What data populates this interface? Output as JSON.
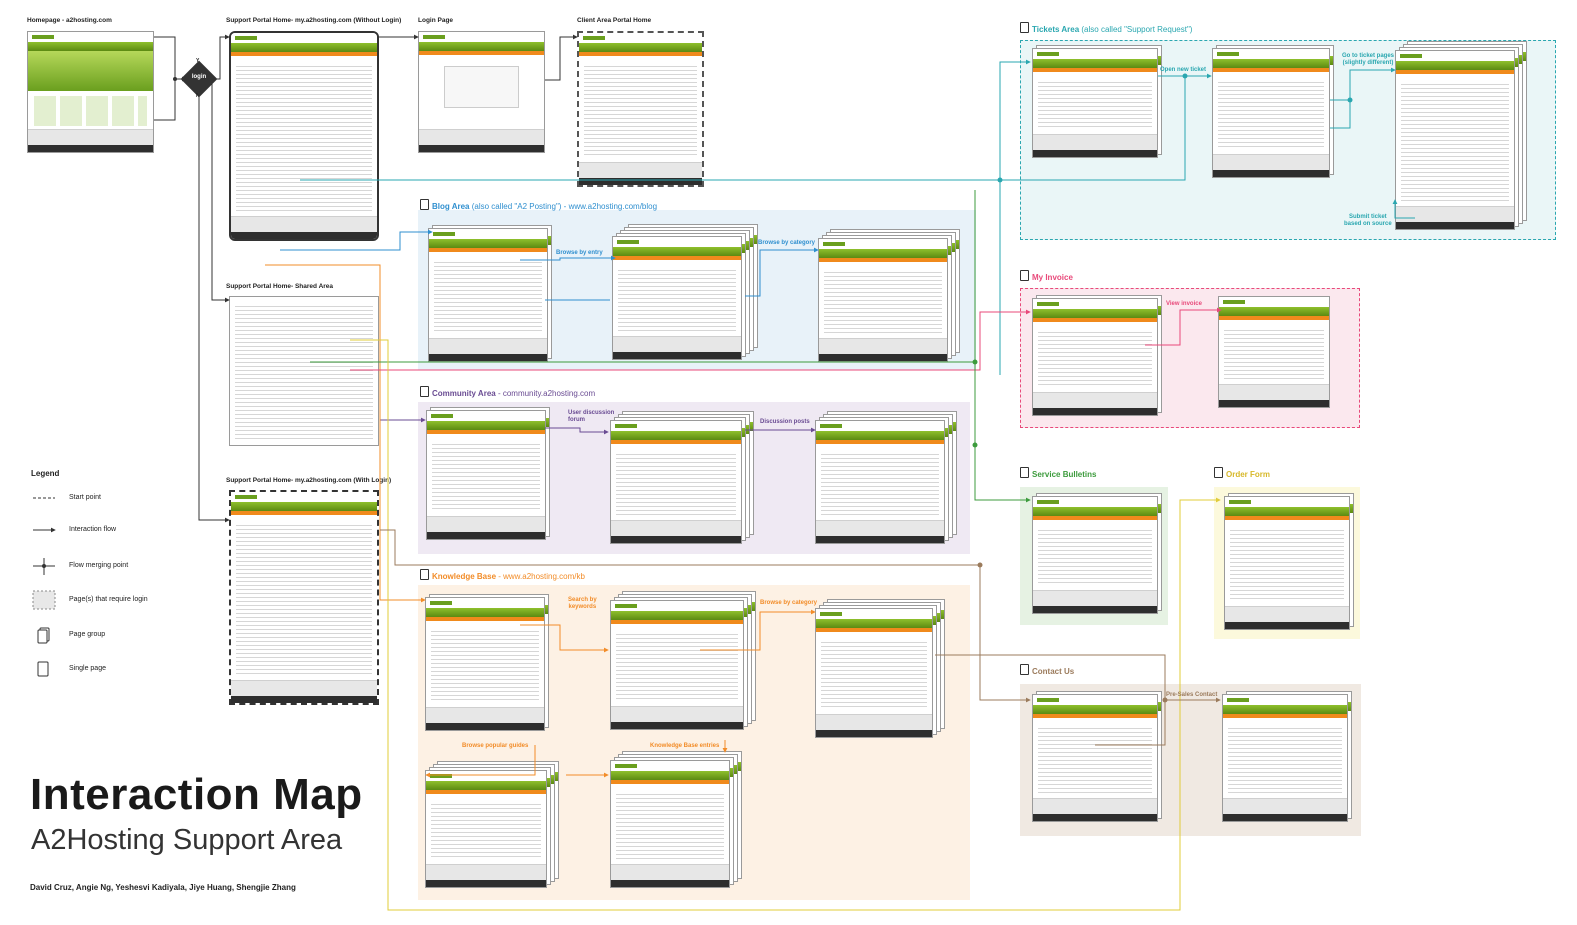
{
  "title": "Interaction Map",
  "subtitle": "A2Hosting Support Area",
  "authors": "David Cruz, Angie Ng, Yeshesvi Kadiyala, Jiye Huang, Shengjie Zhang",
  "pages": {
    "homepage": "Homepage - a2hosting.com",
    "portal_without_login": "Support Portal Home- my.a2hosting.com (Without Login)",
    "login_page": "Login Page",
    "client_area": "Client Area Portal Home",
    "portal_shared": "Support Portal Home- Shared Area",
    "portal_with_login": "Support Portal Home- my.a2hosting.com (With Login)"
  },
  "decision": {
    "label": "login",
    "yes": "Y",
    "no": "N"
  },
  "areas": {
    "tickets": {
      "title": "Tickets Area",
      "subtitle": "(also called \"Support Request\")"
    },
    "blog": {
      "title": "Blog Area",
      "subtitle": "(also called \"A2 Posting\") - www.a2hosting.com/blog"
    },
    "community": {
      "title": "Community Area",
      "subtitle": " - community.a2hosting.com"
    },
    "kb": {
      "title": "Knowledge Base",
      "subtitle": " - www.a2hosting.com/kb"
    },
    "invoice": {
      "title": "My Invoice"
    },
    "bulletins": {
      "title": "Service Bulletins"
    },
    "order": {
      "title": "Order Form"
    },
    "contact": {
      "title": "Contact Us"
    }
  },
  "notes": {
    "open_new_ticket": "Open new ticket",
    "go_to_ticket": "Go to ticket pages\n(slightly different)",
    "submit_ticket": "Submit ticket\nbased on source",
    "browse_by_entry": "Browse by entry",
    "browse_by_category_blog": "Browse by category",
    "view_invoice": "View invoice",
    "user_discussion_forum": "User discussion\nforum",
    "discussion_posts": "Discussion posts",
    "search_by_keywords": "Search by\nkeywords",
    "browse_by_category_kb": "Browse by category",
    "browse_popular_guides": "Browse popular guides",
    "kb_entries": "Knowledge Base entries",
    "pre_sales_contact": "Pre-Sales Contact"
  },
  "legend": {
    "title": "Legend",
    "items": [
      "Start point",
      "Interaction flow",
      "Flow merging point",
      "Page(s) that require login",
      "Page group",
      "Single page"
    ]
  },
  "colors": {
    "tickets": "#2aa7b0",
    "blog": "#2f8fcf",
    "community": "#6a4c93",
    "kb": "#f28c28",
    "invoice": "#e8497a",
    "bulletins": "#3c9b3c",
    "order": "#e8d84a",
    "contact": "#9b7b5c",
    "brand_green": "#6a9f1e"
  }
}
